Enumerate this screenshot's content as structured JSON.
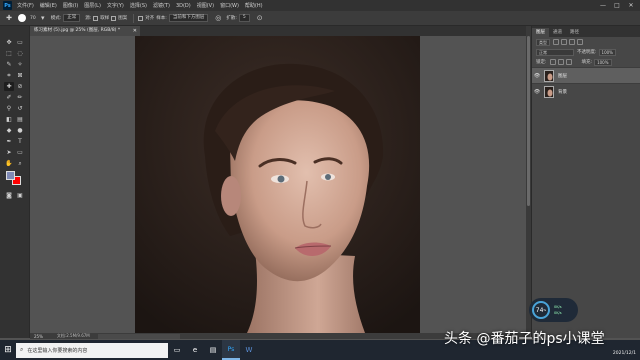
{
  "app": {
    "logo": "Ps"
  },
  "menubar": {
    "items": [
      "文件(F)",
      "编辑(E)",
      "图像(I)",
      "图层(L)",
      "文字(Y)",
      "选择(S)",
      "滤镜(T)",
      "3D(D)",
      "视图(V)",
      "窗口(W)",
      "帮助(H)"
    ],
    "window_controls": [
      "—",
      "□",
      "✕"
    ]
  },
  "options_bar": {
    "brush_size": "70",
    "mode_label": "模式:",
    "mode_value": "正常",
    "source_label": "源:",
    "source_sampled": "取样",
    "source_pattern": "图案",
    "aligned": "对齐",
    "sample_label": "样本:",
    "sample_value": "当前和下方图层",
    "diffusion_label": "扩散:",
    "diffusion_value": "5"
  },
  "document_tab": {
    "title": "练习素材 (5).jpg @ 25% (图层, RGB/8) *",
    "close": "✕"
  },
  "toolbar": {
    "foreground_color": "#7f8ab6",
    "background_color": "#ff0000"
  },
  "status_bar": {
    "zoom": "25%",
    "doc_info": "文档:2.5M/9.67M"
  },
  "layers_panel": {
    "tabs": [
      "图层",
      "通道",
      "路径"
    ],
    "filter_kind": "类型",
    "blend_mode": "正常",
    "opacity_label": "不透明度:",
    "opacity_value": "100%",
    "lock_label": "锁定:",
    "fill_label": "填充:",
    "fill_value": "100%",
    "layers": [
      {
        "name": "图层",
        "selected": true
      },
      {
        "name": "背景",
        "selected": false
      }
    ]
  },
  "perf_widget": {
    "value": "74",
    "unit": "%",
    "upload": "0K/s",
    "download": "0K/s"
  },
  "taskbar": {
    "start_icon": "⊞",
    "search_placeholder": "在这里输入你要搜索的内容",
    "apps": [
      "▭",
      "e",
      "▤",
      "Ps",
      "W"
    ],
    "time": "22:34",
    "date": "2021/12/1"
  },
  "watermark": {
    "text": "头条 @番茄子的ps小课堂"
  },
  "colors": {
    "menubar": "#323232",
    "workspace": "#535353",
    "panel": "#474747",
    "taskbar": "#1f2630"
  }
}
